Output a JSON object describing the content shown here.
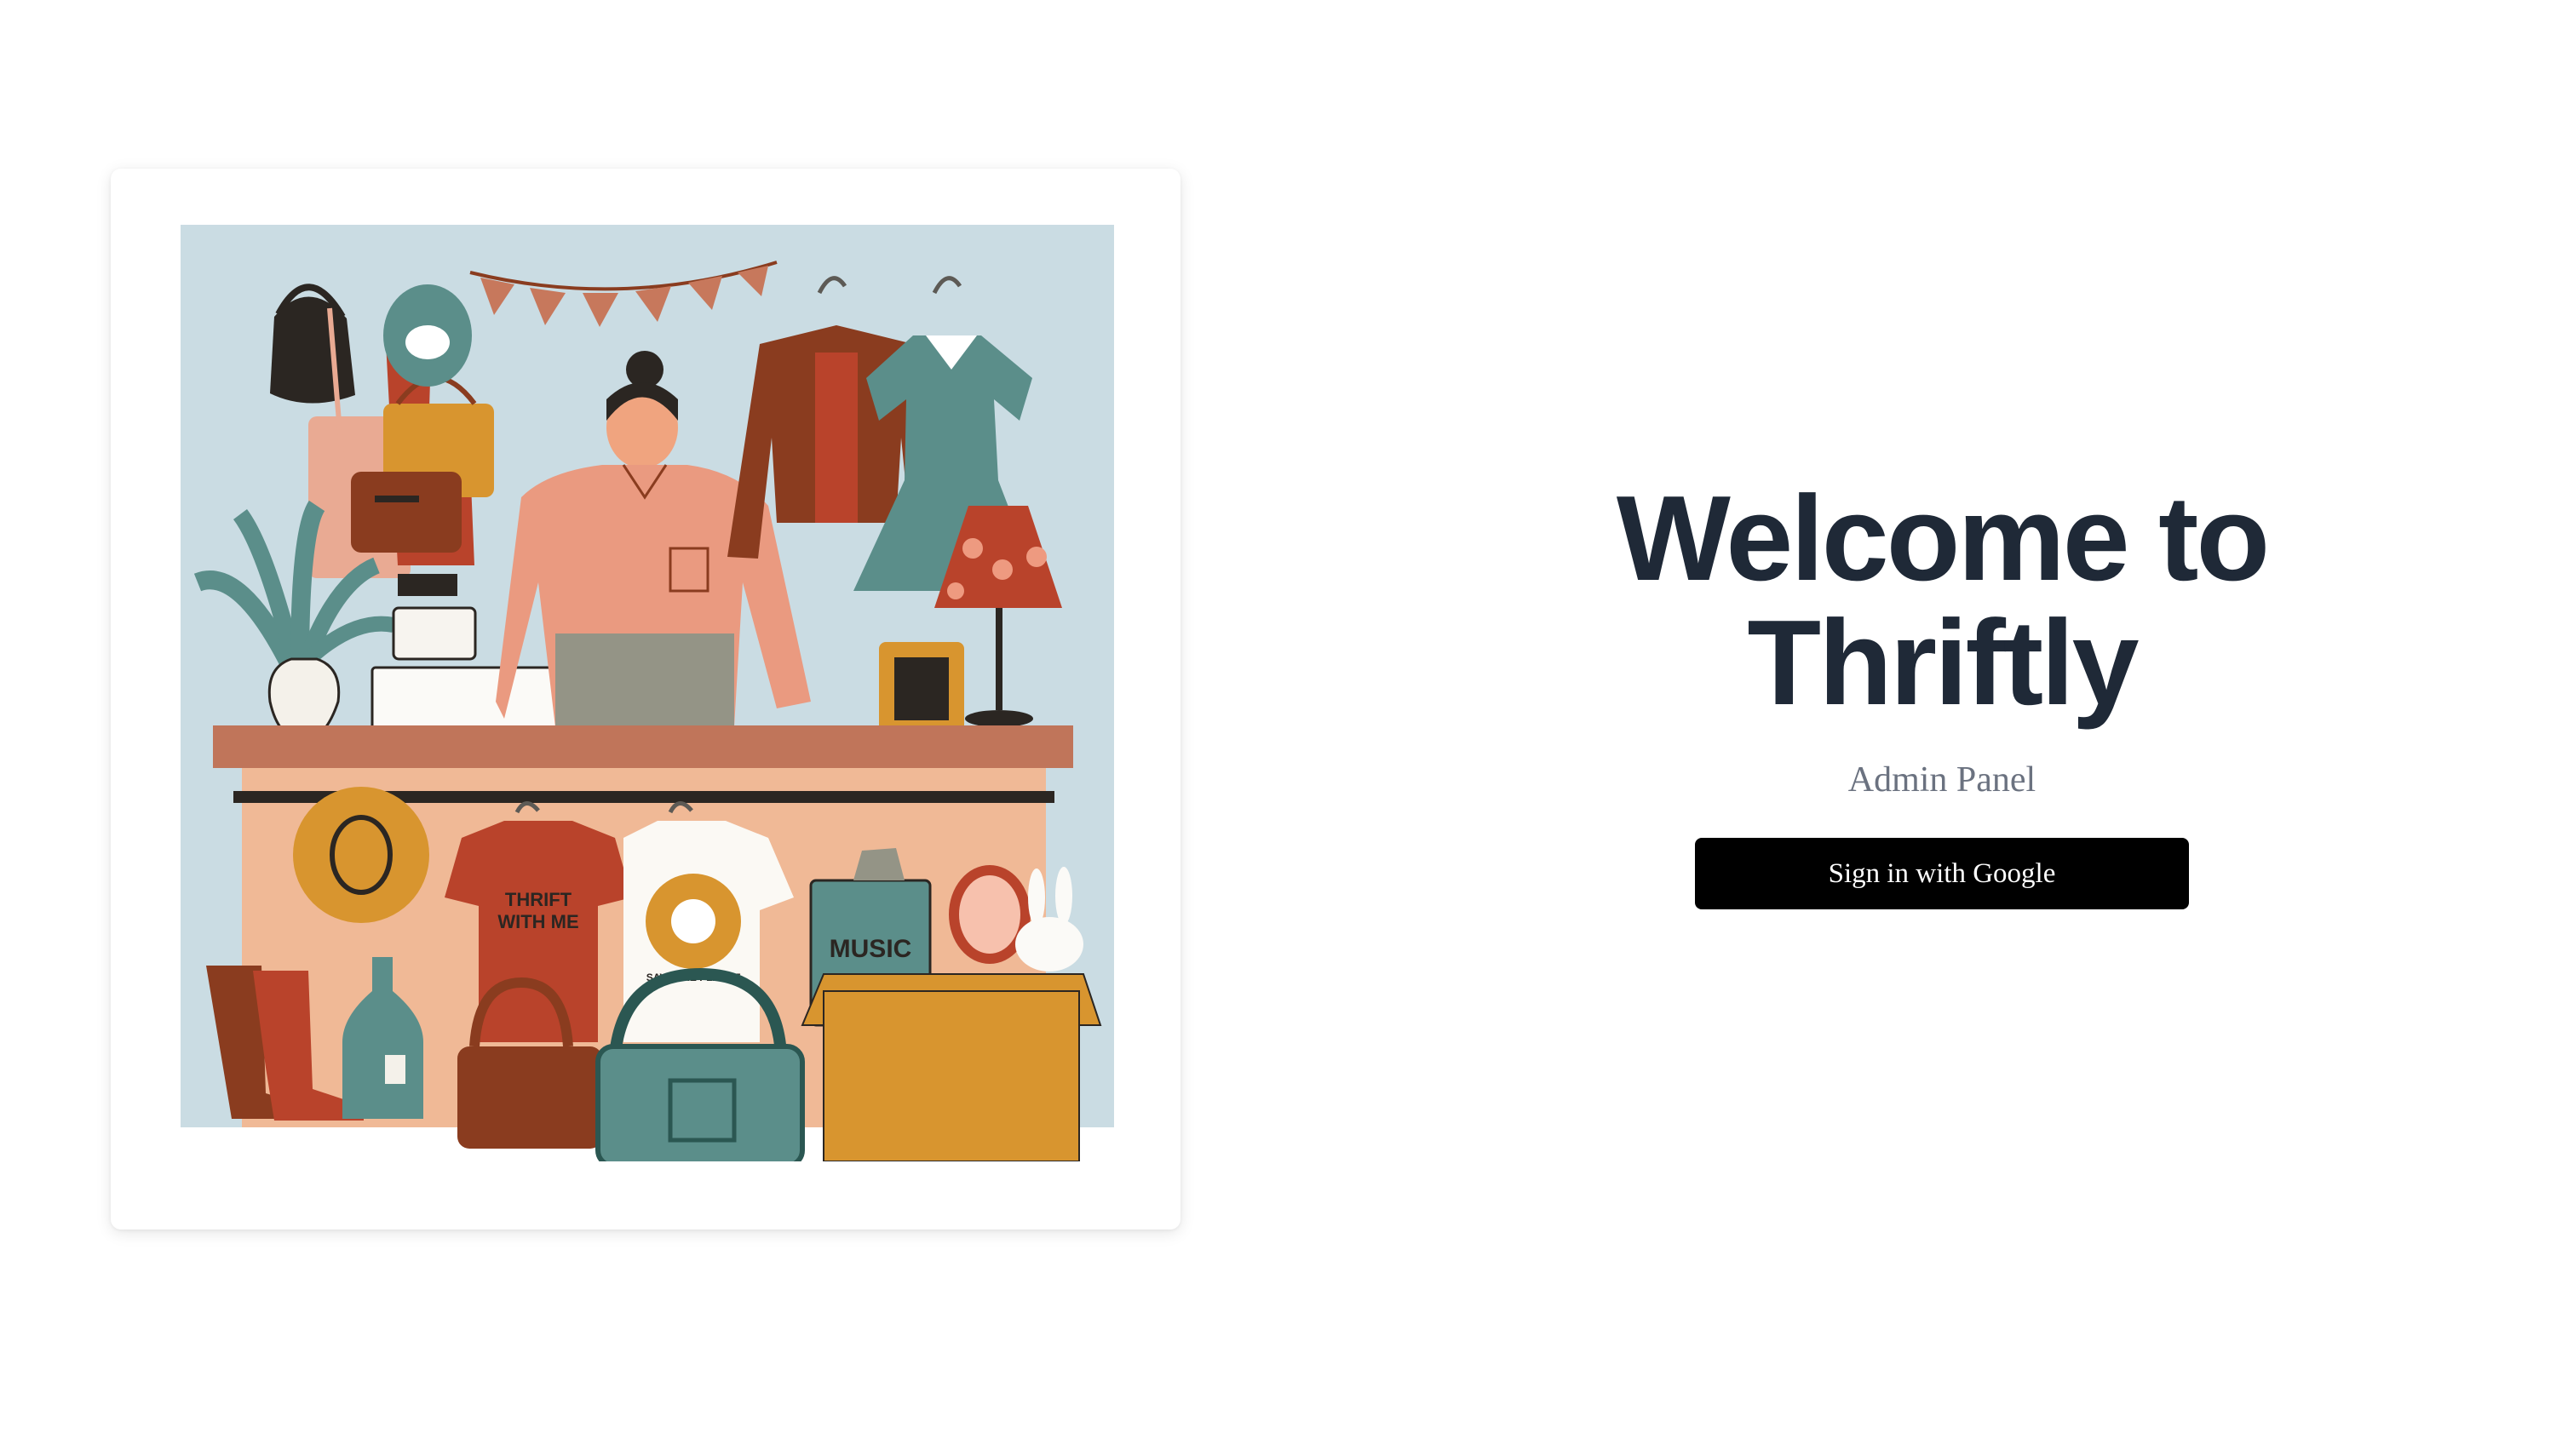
{
  "hero": {
    "title_line1": "Welcome to",
    "title_line2": "Thriftly",
    "subtitle": "Admin Panel"
  },
  "auth": {
    "google_button_label": "Sign in with Google"
  },
  "illustration": {
    "tshirt_left_text_line1": "THRIFT",
    "tshirt_left_text_line2": "WITH ME",
    "tshirt_right_text": "SAVE THE PLANET",
    "music_box_label": "MUSIC",
    "colors": {
      "background": "#cadce3",
      "counter_top": "#c0755a",
      "counter_front": "#f0b996",
      "rust": "#b9432b",
      "brown": "#8a3c1f",
      "teal": "#5b8e8a",
      "mustard": "#d8952f",
      "salmon": "#ea9a80",
      "dark": "#2b2622"
    }
  }
}
